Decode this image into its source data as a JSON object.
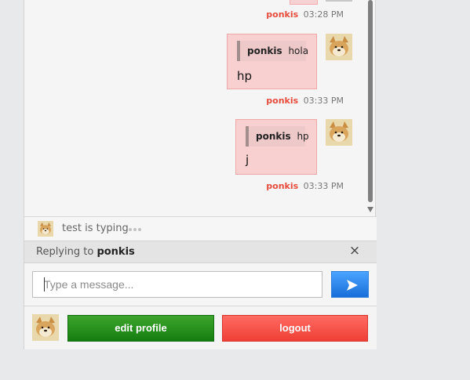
{
  "messages": [
    {
      "author": "ponkis",
      "time": "03:28 PM"
    },
    {
      "quote_author": "ponkis",
      "quote_text": "hola",
      "text": "hp",
      "author": "ponkis",
      "time": "03:33 PM"
    },
    {
      "quote_author": "ponkis",
      "quote_text": "hp",
      "text": "j",
      "author": "ponkis",
      "time": "03:33 PM"
    }
  ],
  "typing": {
    "text": "test is typing"
  },
  "reply": {
    "prefix": "Replying to",
    "target": "ponkis",
    "close_glyph": "×"
  },
  "composer": {
    "placeholder": "Type a message...",
    "value": ""
  },
  "actions": {
    "edit_profile": "edit profile",
    "logout": "logout"
  },
  "theme": {
    "accent_red": "#e74c3c",
    "bubble_bg": "#f8d0d0",
    "send_blue": "#2f8df5",
    "edit_green": "#1f8f17",
    "logout_red": "#ff5a52"
  },
  "icons": {
    "send": "send-arrow-icon",
    "close": "close-icon",
    "avatar": "shiba-avatar-icon"
  }
}
